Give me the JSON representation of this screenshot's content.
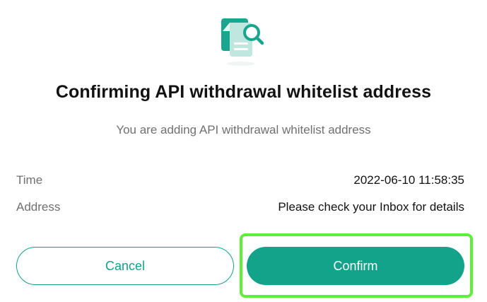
{
  "dialog": {
    "icon": "document-search-icon",
    "title": "Confirming API withdrawal whitelist address",
    "subtitle": "You are adding API withdrawal whitelist address",
    "details": [
      {
        "label": "Time",
        "value": "2022-06-10 11:58:35"
      },
      {
        "label": "Address",
        "value": "Please check your Inbox for details"
      }
    ],
    "buttons": {
      "cancel_label": "Cancel",
      "confirm_label": "Confirm"
    }
  },
  "colors": {
    "accent": "#13a38a",
    "highlight": "#5cf03a",
    "text_primary": "#121212",
    "text_secondary": "#707070"
  }
}
